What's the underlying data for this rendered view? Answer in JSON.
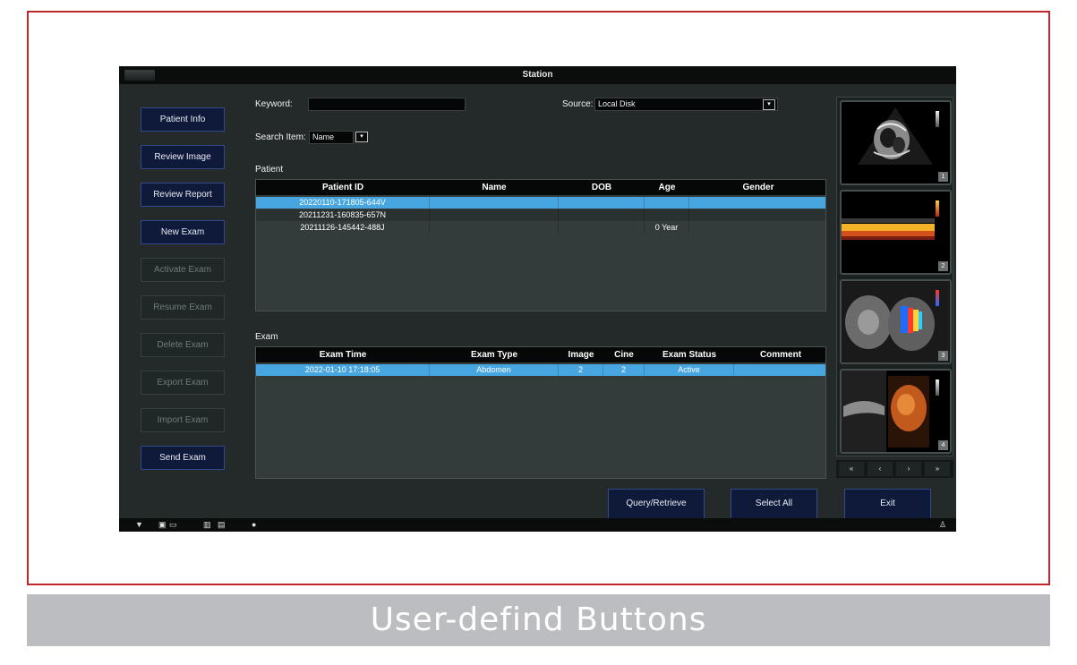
{
  "window": {
    "title": "Station"
  },
  "left_buttons": [
    {
      "label": "Patient Info",
      "enabled": true
    },
    {
      "label": "Review Image",
      "enabled": true
    },
    {
      "label": "Review Report",
      "enabled": true
    },
    {
      "label": "New Exam",
      "enabled": true
    },
    {
      "label": "Activate Exam",
      "enabled": false
    },
    {
      "label": "Resume Exam",
      "enabled": false
    },
    {
      "label": "Delete Exam",
      "enabled": false
    },
    {
      "label": "Export Exam",
      "enabled": false
    },
    {
      "label": "Import Exam",
      "enabled": false
    },
    {
      "label": "Send Exam",
      "enabled": true
    }
  ],
  "search": {
    "keyword_label": "Keyword:",
    "keyword_value": "",
    "source_label": "Source:",
    "source_value": "Local Disk",
    "item_label": "Search Item:",
    "item_value": "Name"
  },
  "patient_table": {
    "section_label": "Patient",
    "columns": [
      "Patient ID",
      "Name",
      "DOB",
      "Age",
      "Gender"
    ],
    "rows": [
      {
        "cells": [
          "20220110-171805-644V",
          "",
          "",
          "",
          ""
        ],
        "selected": true
      },
      {
        "cells": [
          "20211231-160835-657N",
          "",
          "",
          "",
          ""
        ],
        "selected": false
      },
      {
        "cells": [
          "20211126-145442-488J",
          "",
          "",
          "0 Year",
          ""
        ],
        "selected": false
      }
    ]
  },
  "exam_table": {
    "section_label": "Exam",
    "columns": [
      "Exam Time",
      "Exam Type",
      "Image",
      "Cine",
      "Exam Status",
      "Comment"
    ],
    "rows": [
      {
        "cells": [
          "2022-01-10 17:18:05",
          "Abdomen",
          "2",
          "2",
          "Active",
          ""
        ],
        "selected": true
      }
    ]
  },
  "thumbnails": [
    {
      "number": "1",
      "kind": "cardiac"
    },
    {
      "number": "2",
      "kind": "vessel-doppler"
    },
    {
      "number": "3",
      "kind": "color-doppler"
    },
    {
      "number": "4",
      "kind": "3d-render"
    }
  ],
  "thumb_nav": [
    "«",
    "‹",
    "›",
    "»"
  ],
  "bottom_buttons": {
    "query": "Query/Retrieve",
    "select_all": "Select All",
    "exit": "Exit"
  },
  "caption": "User-defind Buttons",
  "colors": {
    "button_bg": "#0f1a3a",
    "selection": "#47a6e0",
    "frame_border": "#c0272d",
    "caption_bg": "#bcbdc0"
  }
}
